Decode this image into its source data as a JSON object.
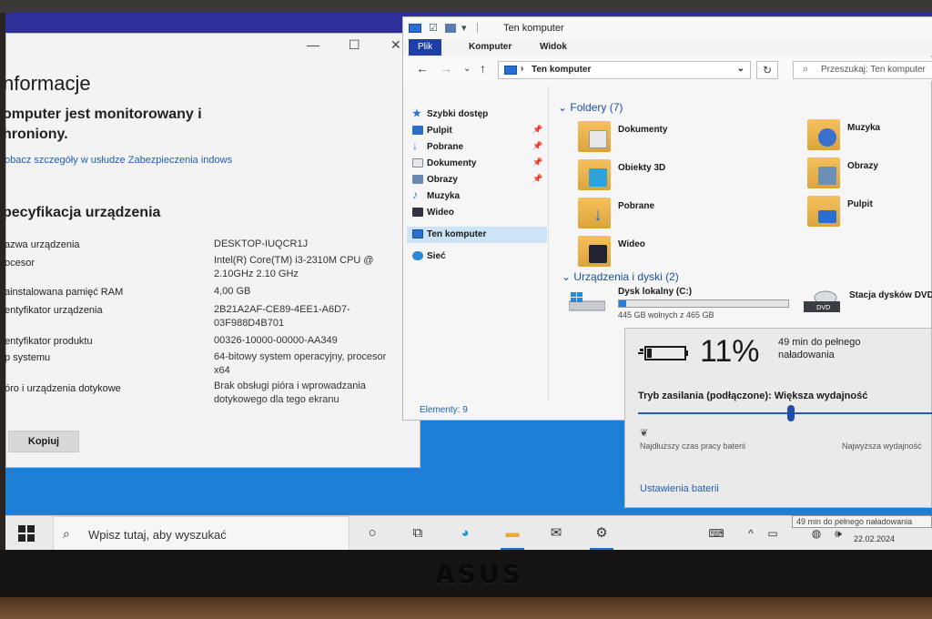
{
  "about": {
    "title": "nformacje",
    "protect_text": "omputer jest monitorowany i hroniony.",
    "security_link": "obacz szczegóły w usłudze Zabezpieczenia indows",
    "spec_title": "pecyfikacja urządzenia",
    "specs": [
      {
        "label": "azwa urządzenia",
        "value": "DESKTOP-IUQCR1J"
      },
      {
        "label": "ocesor",
        "value": "Intel(R) Core(TM) i3-2310M CPU @ 2.10GHz   2.10 GHz"
      },
      {
        "label": "ainstalowana pamięć RAM",
        "value": "4,00 GB"
      },
      {
        "label": "entyfikator urządzenia",
        "value": "2B21A2AF-CE89-4EE1-A6D7-03F988D4B701"
      },
      {
        "label": "entyfikator produktu",
        "value": "00326-10000-00000-AA349"
      },
      {
        "label": "p systemu",
        "value": "64-bitowy system operacyjny, procesor x64"
      },
      {
        "label": "óro i urządzenia dotykowe",
        "value": "Brak obsługi pióra i wprowadzania dotykowego dla tego ekranu"
      }
    ],
    "copy_button": "Kopiuj",
    "window_controls": [
      "—",
      "☐",
      "✕"
    ]
  },
  "explorer": {
    "title": "Ten komputer",
    "ribbon_tabs": [
      "Plik",
      "Komputer",
      "Widok"
    ],
    "address": "Ten komputer",
    "search_placeholder": "Przeszukaj: Ten komputer",
    "nav_items": [
      {
        "label": "Szybki dostęp",
        "icon": "star-icon",
        "color": "#2a6fd0",
        "pinned": false
      },
      {
        "label": "Pulpit",
        "icon": "desktop-icon",
        "color": "#2a6fd0",
        "pinned": true
      },
      {
        "label": "Pobrane",
        "icon": "download-icon",
        "color": "#2a6fd0",
        "pinned": true
      },
      {
        "label": "Dokumenty",
        "icon": "documents-icon",
        "color": "#7a8aa0",
        "pinned": true
      },
      {
        "label": "Obrazy",
        "icon": "pictures-icon",
        "color": "#6a8ab0",
        "pinned": true
      },
      {
        "label": "Muzyka",
        "icon": "music-icon",
        "color": "#3a7ad0",
        "pinned": false
      },
      {
        "label": "Wideo",
        "icon": "video-icon",
        "color": "#333344",
        "pinned": false
      }
    ],
    "nav_this_pc": "Ten komputer",
    "nav_network": "Sieć",
    "folders_header": "Foldery (7)",
    "folders": [
      {
        "label": "Dokumenty",
        "overlay": "#e8e8e8"
      },
      {
        "label": "Muzyka",
        "overlay": "#3a6fd0"
      },
      {
        "label": "Obiekty 3D",
        "overlay": "#2ea3d8"
      },
      {
        "label": "Obrazy",
        "overlay": "#6a90b8"
      },
      {
        "label": "Pobrane",
        "overlay": "#2a6fd0"
      },
      {
        "label": "Pulpit",
        "overlay": "#2a6fd0"
      },
      {
        "label": "Wideo",
        "overlay": "#222233"
      }
    ],
    "drives_header": "Urządzenia i dyski (2)",
    "drive_c": {
      "name": "Dysk lokalny (C:)",
      "free": "445 GB wolnych z 465 GB",
      "used_fraction": 0.043
    },
    "dvd": {
      "name": "Stacja dysków DVD",
      "badge": "DVD"
    },
    "status": "Elementy: 9"
  },
  "battery": {
    "percent": "11%",
    "time": "49 min do pełnego naładowania",
    "power_mode": "Tryb zasilania (podłączone): Większa wydajność",
    "left_label": "Najdłuższy czas pracy baterii",
    "right_label": "Najwyższa wydajność",
    "settings_link": "Ustawienia baterii",
    "slider_level": 0.5
  },
  "taskbar": {
    "search_placeholder": "Wpisz tutaj, aby wyszukać",
    "date": "22.02.2024",
    "tooltip": "49 min do pełnego naładowania"
  },
  "brand": "ASUS",
  "colors": {
    "accent": "#1e6fd0",
    "link": "#1f5fb4",
    "desktop": "#1d7fd6"
  }
}
